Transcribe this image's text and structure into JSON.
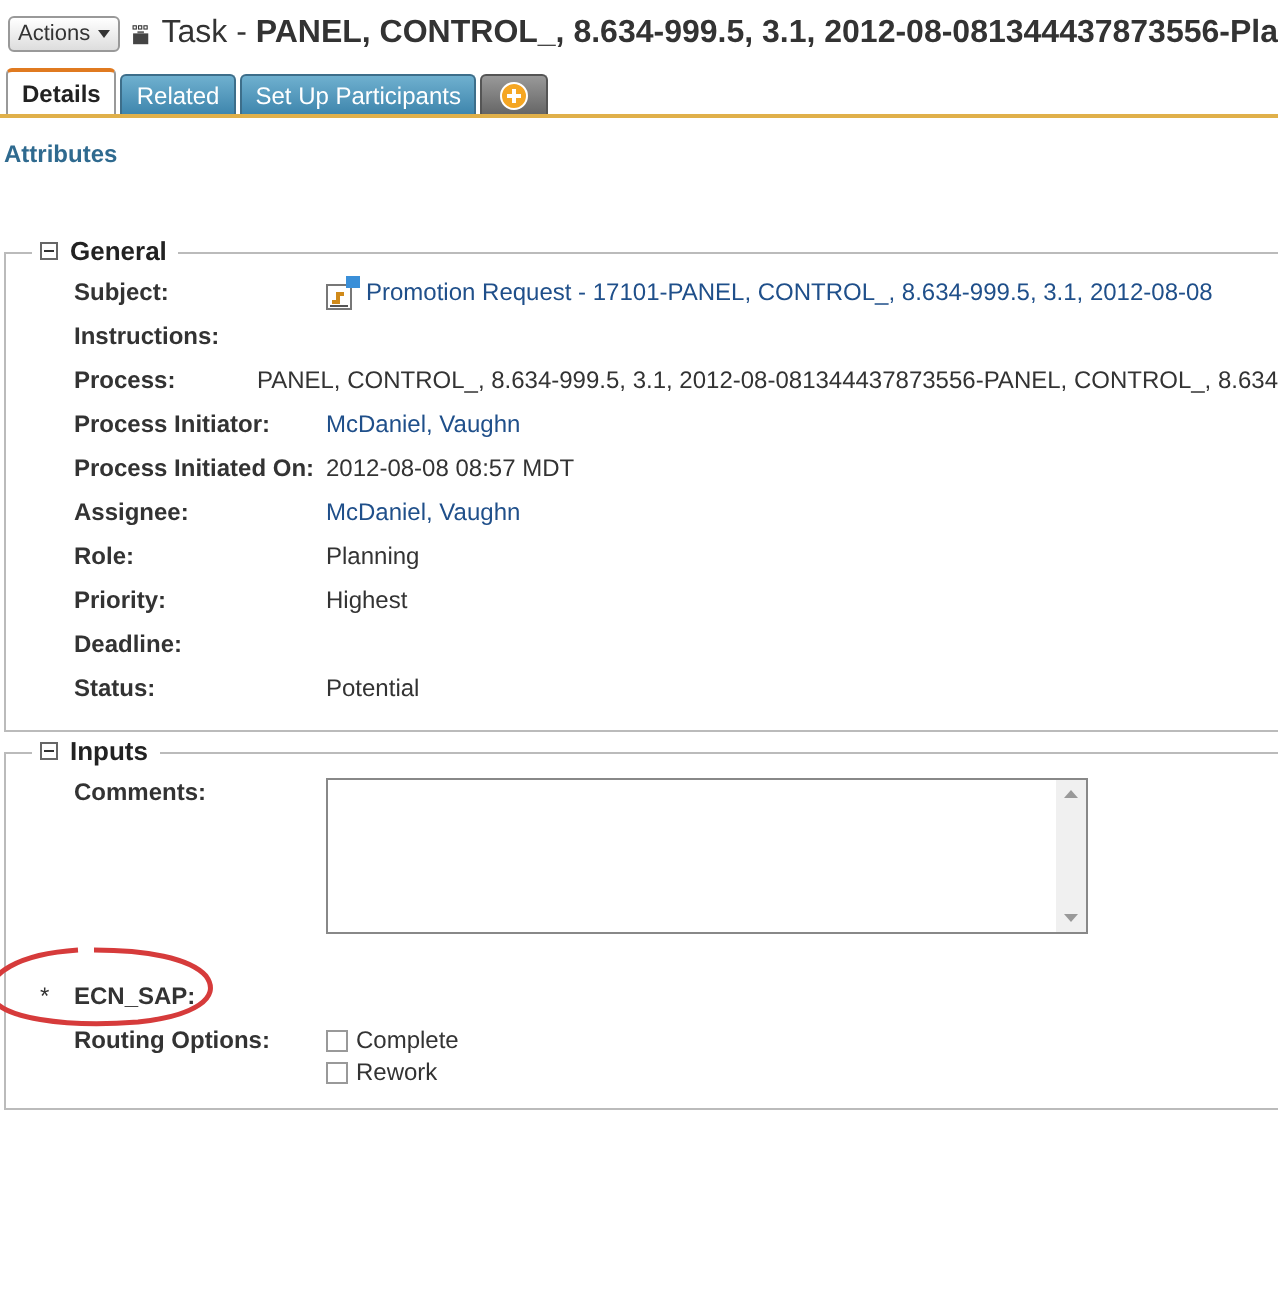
{
  "header": {
    "actions_button": "Actions",
    "title_prefix": "Task - ",
    "title": "PANEL, CONTROL_, 8.634-999.5, 3.1, 2012-08-081344437873556-Pla"
  },
  "tabs": [
    {
      "label": "Details",
      "selected": true,
      "kind": "text"
    },
    {
      "label": "Related",
      "selected": false,
      "kind": "text"
    },
    {
      "label": "Set Up Participants",
      "selected": false,
      "kind": "text"
    },
    {
      "selected": false,
      "kind": "add"
    }
  ],
  "attributes_link": "Attributes",
  "sections": [
    {
      "title": "General",
      "expanded": true,
      "fields": [
        {
          "label": "Subject:",
          "kind": "link",
          "icon": true,
          "value": "Promotion Request - 17101-PANEL, CONTROL_, 8.634-999.5, 3.1, 2012-08-08"
        },
        {
          "label": "Instructions:",
          "kind": "empty"
        },
        {
          "label": "Process:",
          "kind": "text",
          "value": "PANEL, CONTROL_, 8.634-999.5, 3.1, 2012-08-081344437873556-PANEL, CONTROL_, 8.634"
        },
        {
          "label": "Process Initiator:",
          "kind": "link",
          "value": "McDaniel, Vaughn"
        },
        {
          "label": "Process Initiated On:",
          "kind": "text",
          "value": "2012-08-08 08:57 MDT"
        },
        {
          "label": "Assignee:",
          "kind": "link",
          "value": "McDaniel, Vaughn"
        },
        {
          "label": "Role:",
          "kind": "text",
          "value": "Planning"
        },
        {
          "label": "Priority:",
          "kind": "text",
          "value": "Highest"
        },
        {
          "label": "Deadline:",
          "kind": "empty"
        },
        {
          "label": "Status:",
          "kind": "text",
          "value": "Potential"
        }
      ]
    },
    {
      "title": "Inputs",
      "expanded": true,
      "fields": [
        {
          "label": "Comments:",
          "kind": "textarea"
        },
        {
          "label": "ECN_SAP:",
          "kind": "empty",
          "required_mark": "*",
          "highlighted": true
        },
        {
          "label": "Routing Options:",
          "kind": "checkboxes",
          "options": [
            {
              "label": "Complete",
              "checked": false
            },
            {
              "label": "Rework",
              "checked": false
            }
          ]
        }
      ]
    }
  ]
}
